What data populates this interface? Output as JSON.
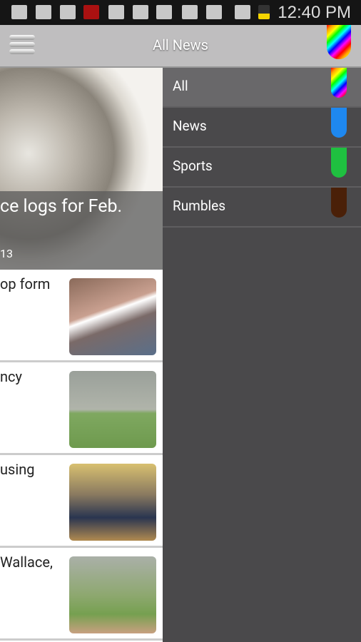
{
  "status_bar": {
    "time": "12:40 PM",
    "icons": [
      "add-icon",
      "gallery-icon",
      "gmail-icon",
      "missed-call-icon",
      "download-icon",
      "sd-card-icon",
      "play-store-icon",
      "mute-icon",
      "wifi-icon",
      "airplane-icon",
      "battery-icon"
    ]
  },
  "app_bar": {
    "title": "All News",
    "menu_icon": "hamburger-icon"
  },
  "hero": {
    "title": "ce logs for Feb.",
    "date": "13"
  },
  "articles": [
    {
      "title": "op form",
      "image": "basketball-player-photo"
    },
    {
      "title": "ncy",
      "image": "baseball-fielder-photo"
    },
    {
      "title": "using",
      "image": "basketball-game-photo"
    },
    {
      "title": "Wallace,",
      "image": "baseball-game-photo"
    }
  ],
  "drawer": {
    "items": [
      {
        "label": "All",
        "color": "rainbow",
        "selected": true
      },
      {
        "label": "News",
        "color": "#1e88f0"
      },
      {
        "label": "Sports",
        "color": "#1fc040"
      },
      {
        "label": "Rumbles",
        "color": "#4a2008"
      }
    ]
  }
}
